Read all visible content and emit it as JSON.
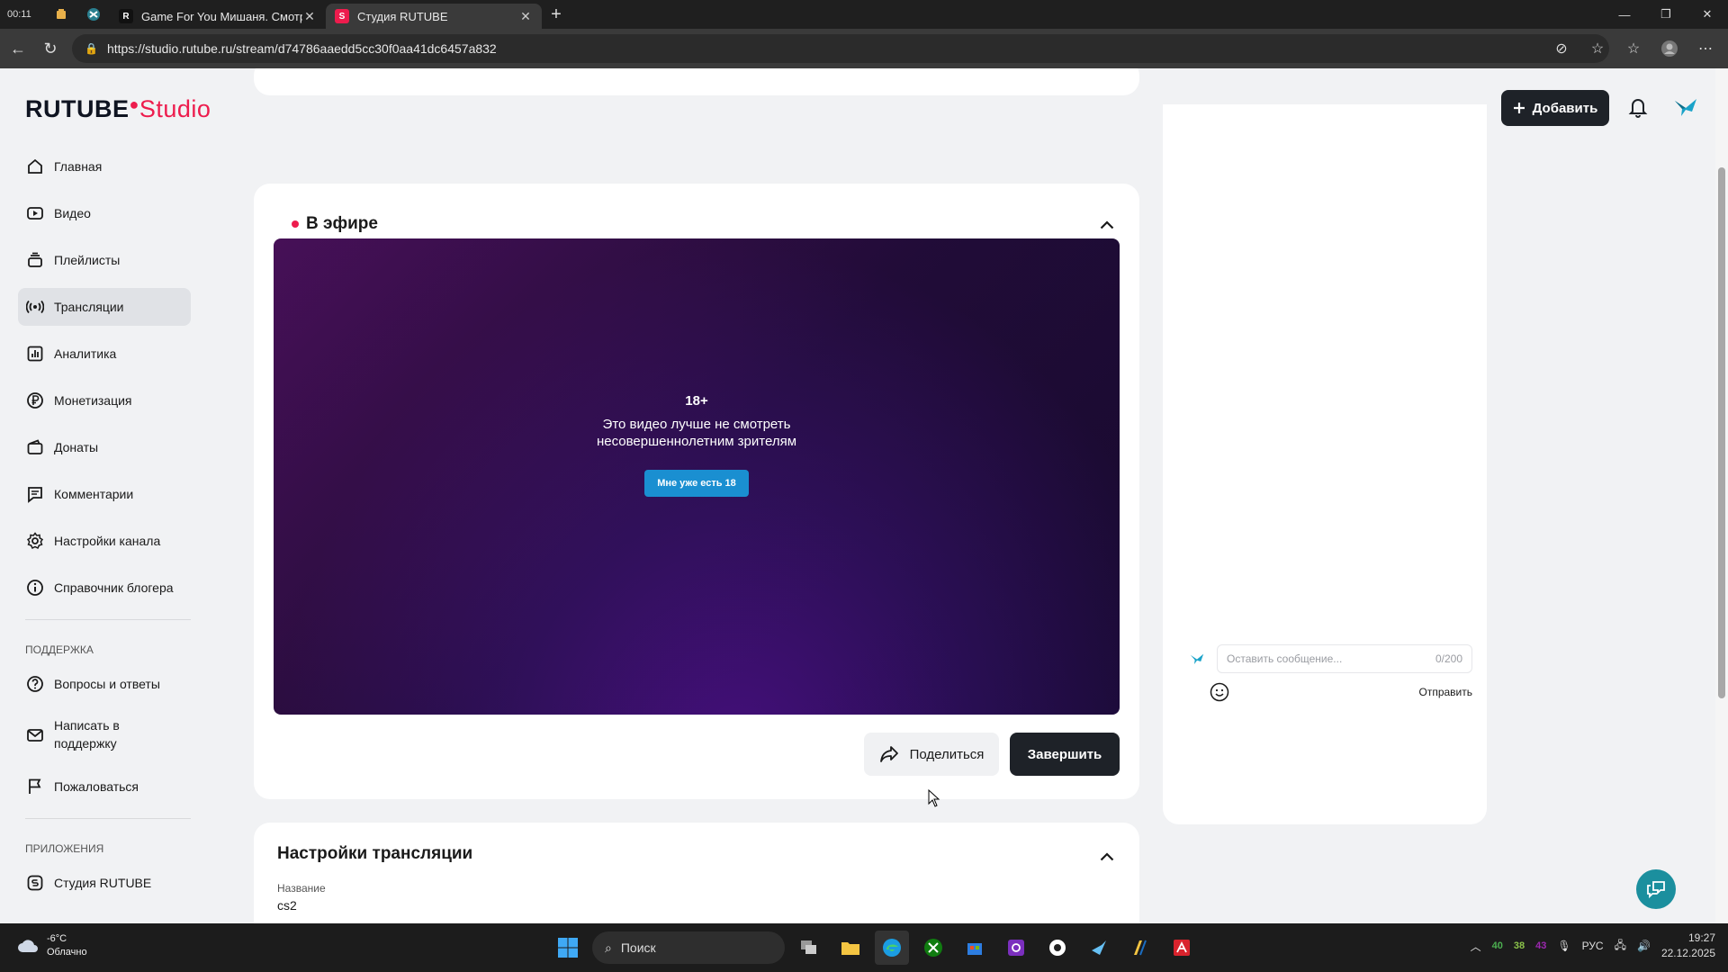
{
  "browser": {
    "clock_tab": "00:11",
    "tabs": [
      {
        "title": "Game For You Мишаня. Смотрит",
        "favicon": "R"
      },
      {
        "title": "Студия RUTUBE",
        "favicon": "S"
      }
    ],
    "url": "https://studio.rutube.ru/stream/d74786aaedd5cc30f0aa41dc6457a832"
  },
  "header": {
    "logo_main": "RUTUBE",
    "logo_studio": "Studio",
    "add_label": "Добавить"
  },
  "sidebar": {
    "items": [
      {
        "label": "Главная",
        "icon": "home-icon"
      },
      {
        "label": "Видео",
        "icon": "video-icon"
      },
      {
        "label": "Плейлисты",
        "icon": "playlist-icon"
      },
      {
        "label": "Трансляции",
        "icon": "broadcast-icon"
      },
      {
        "label": "Аналитика",
        "icon": "analytics-icon"
      },
      {
        "label": "Монетизация",
        "icon": "ruble-icon"
      },
      {
        "label": "Донаты",
        "icon": "wallet-icon"
      },
      {
        "label": "Комментарии",
        "icon": "comments-icon"
      },
      {
        "label": "Настройки канала",
        "icon": "gear-icon"
      },
      {
        "label": "Справочник блогера",
        "icon": "info-icon"
      }
    ],
    "support_title": "ПОДДЕРЖКА",
    "support_items": [
      {
        "label": "Вопросы и ответы",
        "icon": "help-icon"
      },
      {
        "label": "Написать в поддержку",
        "icon": "mail-icon"
      },
      {
        "label": "Пожаловаться",
        "icon": "flag-icon"
      }
    ],
    "apps_title": "ПРИЛОЖЕНИЯ",
    "apps_items": [
      {
        "label": "Студия RUTUBE",
        "icon": "studio-app-icon"
      }
    ]
  },
  "live": {
    "title": "В эфире",
    "age_badge": "18+",
    "warning_line1": "Это видео лучше не смотреть",
    "warning_line2": "несовершеннолетним зрителям",
    "age_confirm": "Мне уже есть 18",
    "share_label": "Поделиться",
    "finish_label": "Завершить"
  },
  "chat": {
    "placeholder": "Оставить сообщение...",
    "counter": "0/200",
    "send_label": "Отправить"
  },
  "settings": {
    "title": "Настройки трансляции",
    "name_label": "Название",
    "name_value": "cs2"
  },
  "taskbar": {
    "temperature": "-6°C",
    "weather_text": "Облачно",
    "search_label": "Поиск",
    "tray_values": [
      "40",
      "38",
      "43"
    ],
    "language": "РУС",
    "time": "19:27",
    "date": "22.12.2025"
  },
  "colors": {
    "brand_red": "#ed1c4d",
    "dark_button": "#1e2228",
    "age_button": "#1a8fd1",
    "help_fab": "#1b8f9e"
  }
}
